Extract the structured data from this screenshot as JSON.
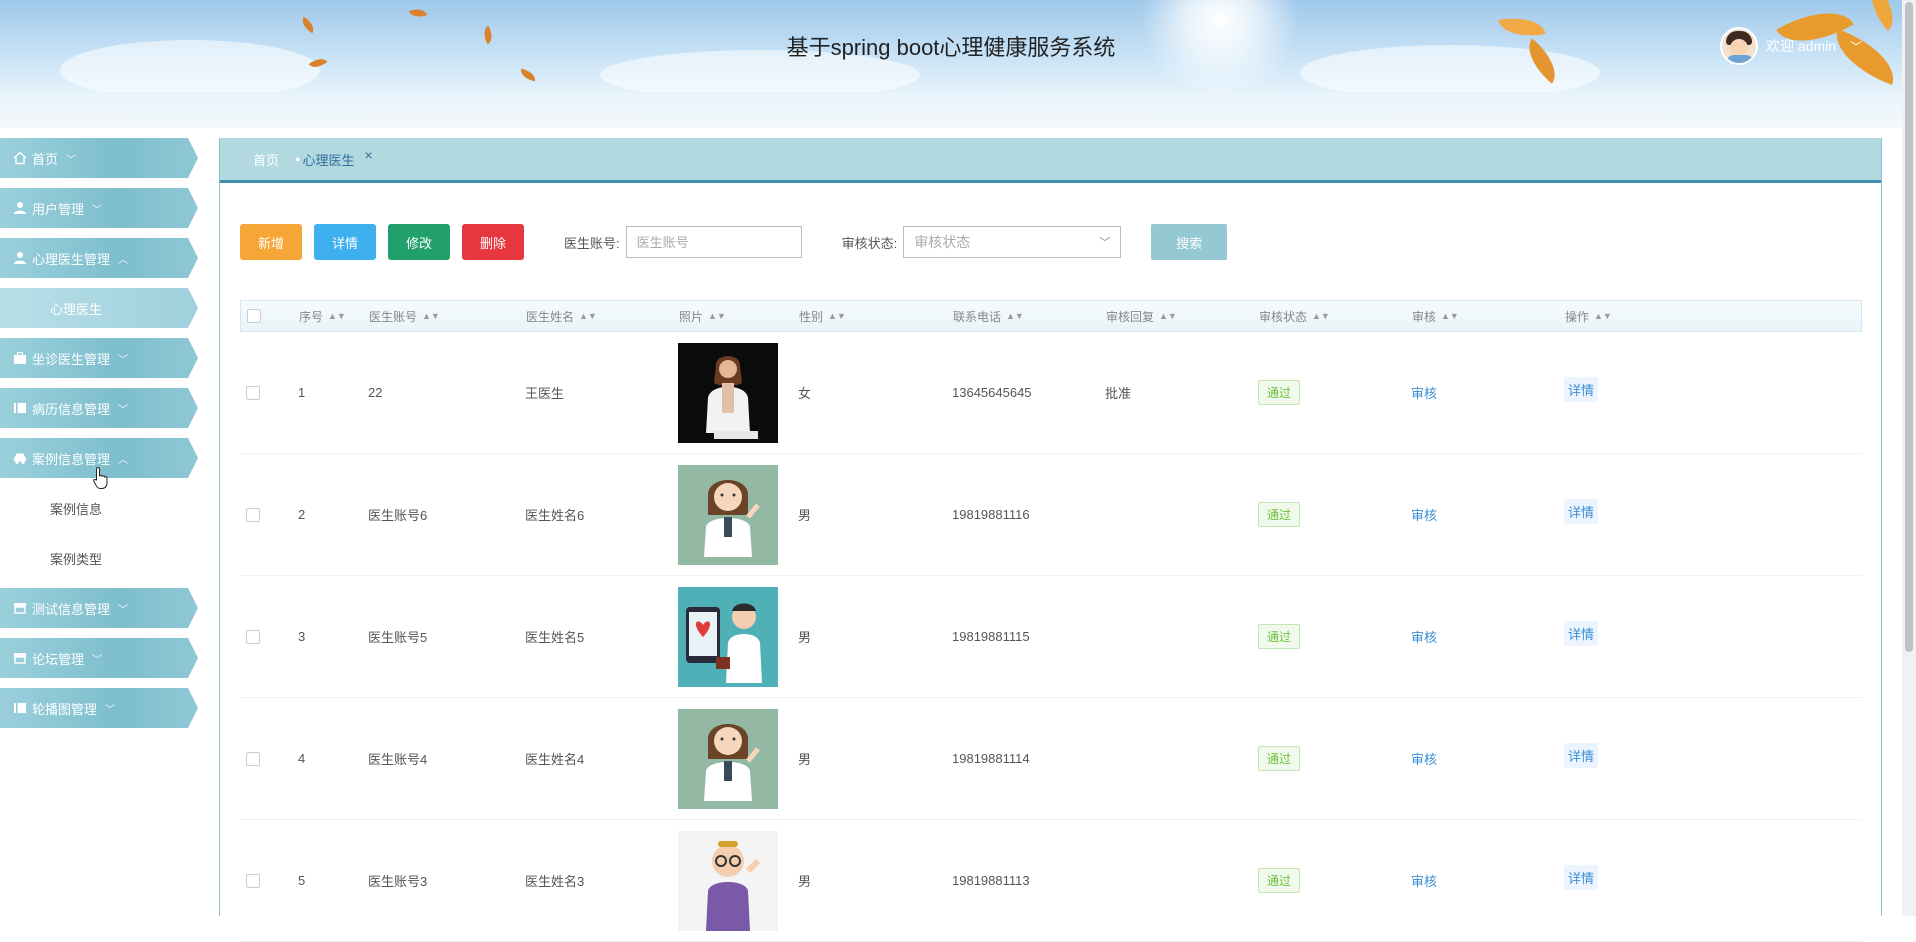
{
  "header": {
    "title": "基于spring boot心理健康服务系统",
    "user_greeting": "欢迎 admin"
  },
  "sidebar": {
    "items": [
      {
        "label": "首页",
        "icon": "home-icon",
        "expanded": false
      },
      {
        "label": "用户管理",
        "icon": "user-icon",
        "expanded": false
      },
      {
        "label": "心理医生管理",
        "icon": "user-icon",
        "expanded": true,
        "children": [
          {
            "label": "心理医生",
            "active": true
          }
        ]
      },
      {
        "label": "坐诊医生管理",
        "icon": "briefcase-icon",
        "expanded": false
      },
      {
        "label": "病历信息管理",
        "icon": "book-icon",
        "expanded": false
      },
      {
        "label": "案例信息管理",
        "icon": "car-icon",
        "expanded": true,
        "children": [
          {
            "label": "案例信息",
            "active": false
          },
          {
            "label": "案例类型",
            "active": false
          }
        ]
      },
      {
        "label": "测试信息管理",
        "icon": "shop-icon",
        "expanded": false
      },
      {
        "label": "论坛管理",
        "icon": "shop-icon",
        "expanded": false
      },
      {
        "label": "轮播图管理",
        "icon": "book-icon",
        "expanded": false
      }
    ]
  },
  "tabs": {
    "home": "首页",
    "active": "心理医生",
    "close": "×"
  },
  "toolbar": {
    "add": "新增",
    "detail": "详情",
    "edit": "修改",
    "delete": "删除",
    "account_label": "医生账号:",
    "account_placeholder": "医生账号",
    "status_label": "审核状态:",
    "status_placeholder": "审核状态",
    "search": "搜索"
  },
  "table": {
    "columns": [
      "序号",
      "医生账号",
      "医生姓名",
      "照片",
      "性别",
      "联系电话",
      "审核回复",
      "审核状态",
      "审核",
      "操作"
    ],
    "rows": [
      {
        "no": "1",
        "account": "22",
        "name": "王医生",
        "sex": "女",
        "tel": "13645645645",
        "reply": "批准",
        "status": "通过",
        "audit": "审核",
        "op": "详情"
      },
      {
        "no": "2",
        "account": "医生账号6",
        "name": "医生姓名6",
        "sex": "男",
        "tel": "19819881116",
        "reply": "",
        "status": "通过",
        "audit": "审核",
        "op": "详情"
      },
      {
        "no": "3",
        "account": "医生账号5",
        "name": "医生姓名5",
        "sex": "男",
        "tel": "19819881115",
        "reply": "",
        "status": "通过",
        "audit": "审核",
        "op": "详情"
      },
      {
        "no": "4",
        "account": "医生账号4",
        "name": "医生姓名4",
        "sex": "男",
        "tel": "19819881114",
        "reply": "",
        "status": "通过",
        "audit": "审核",
        "op": "详情"
      },
      {
        "no": "5",
        "account": "医生账号3",
        "name": "医生姓名3",
        "sex": "男",
        "tel": "19819881113",
        "reply": "",
        "status": "通过",
        "audit": "审核",
        "op": "详情"
      }
    ]
  },
  "colors": {
    "add": "#f5a637",
    "detail": "#3fb0ef",
    "edit": "#22a06b",
    "delete": "#e7373e",
    "search": "#94c9d4",
    "sidebar": "#7dbecd",
    "status_pass": "#67c23a",
    "link": "#3a8fd6"
  }
}
